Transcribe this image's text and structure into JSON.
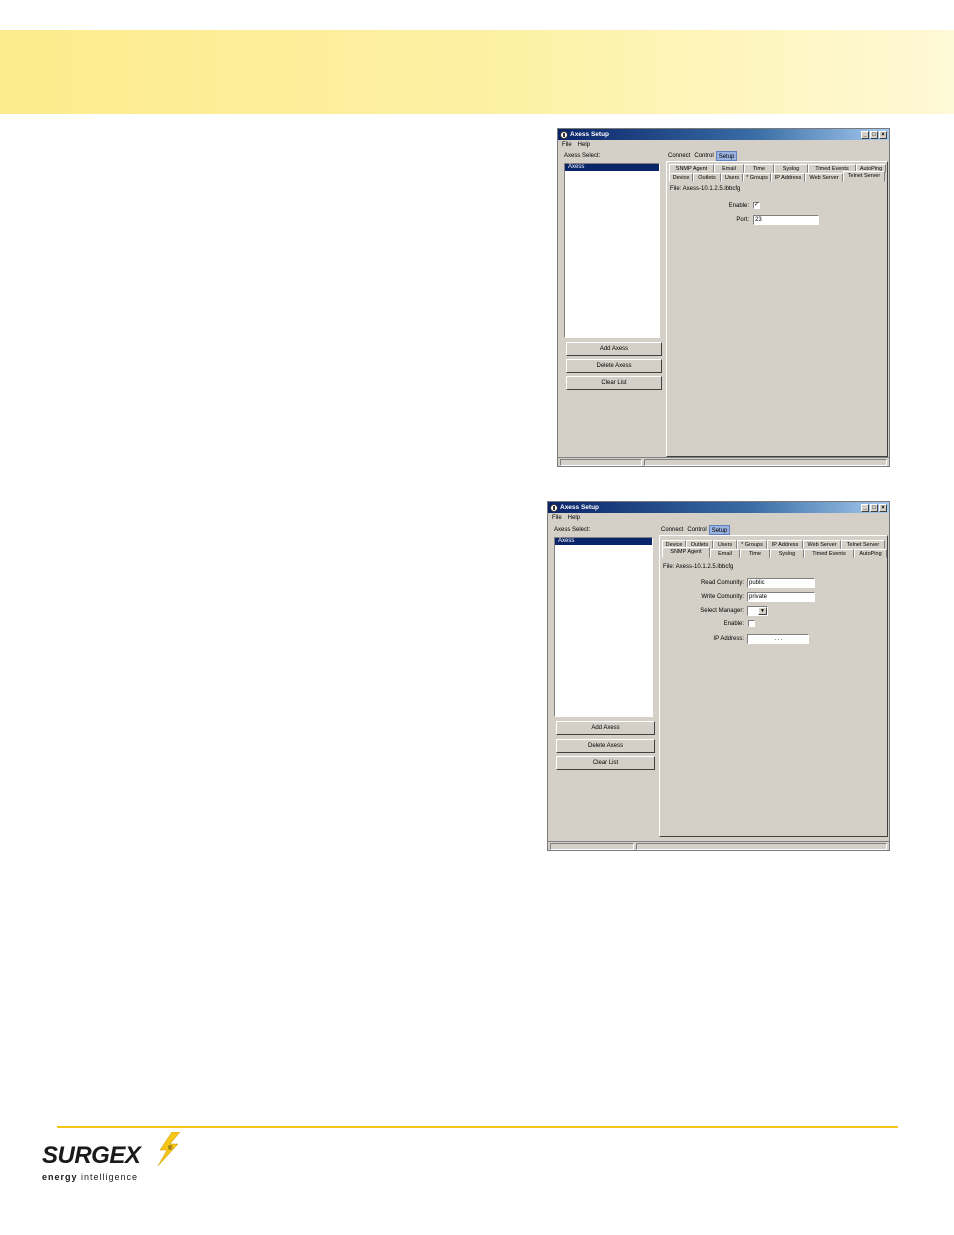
{
  "windows": [
    {
      "title": "Axess Setup",
      "menu": [
        "File",
        "Help"
      ],
      "axess_select_label": "Axess Select:",
      "list_items": [
        "Axess"
      ],
      "buttons": {
        "add": "Add Axess",
        "delete": "Delete Axess",
        "clear": "Clear List"
      },
      "top_tabs": [
        "Connect",
        "Control",
        "Setup"
      ],
      "active_top_tab": "Setup",
      "tab_row_back": [
        "SNMP Agent",
        "Email",
        "Time",
        "Syslog",
        "Timed Events",
        "AutoPing"
      ],
      "tab_row_front": [
        "Device",
        "Outlets",
        "Users",
        "* Groups",
        "IP Address",
        "Web Server",
        "Telnet Server"
      ],
      "selected_tab": "Telnet Server",
      "file_label": "File: Axess-10.1.2.5.lbbcfg",
      "fields": {
        "enable_label": "Enable:",
        "enable_checked": "✓",
        "port_label": "Port:",
        "port_value": "23"
      }
    },
    {
      "title": "Axess Setup",
      "menu": [
        "File",
        "Help"
      ],
      "axess_select_label": "Axess Select:",
      "list_items": [
        "Axess"
      ],
      "buttons": {
        "add": "Add Axess",
        "delete": "Delete Axess",
        "clear": "Clear List"
      },
      "top_tabs": [
        "Connect",
        "Control",
        "Setup"
      ],
      "active_top_tab": "Setup",
      "tab_row_back": [
        "Device",
        "Outlets",
        "Users",
        "* Groups",
        "IP Address",
        "Web Server",
        "Telnet Server"
      ],
      "tab_row_front": [
        "SNMP Agent",
        "Email",
        "Time",
        "Syslog",
        "Timed Events",
        "AutoPing"
      ],
      "selected_tab": "SNMP Agent",
      "file_label": "File: Axess-10.1.2.5.lbbcfg",
      "fields": {
        "read_label": "Read Comunity:",
        "read_value": "public",
        "write_label": "Write Comunity:",
        "write_value": "private",
        "manager_label": "Select Manager:",
        "enable_label": "Enable:",
        "ip_label": "IP Address:",
        "ip_value": ".   .   ."
      }
    }
  ],
  "logo": {
    "wordmark": "SURGEX",
    "registered": "®",
    "tagline_bold": "energy",
    "tagline_rest": " intelligence"
  },
  "colors": {
    "header_band": "#fdeb8c",
    "footer_rule": "#f5c518",
    "titlebar": "#0a246a",
    "window_bg": "#d4d0c8"
  }
}
